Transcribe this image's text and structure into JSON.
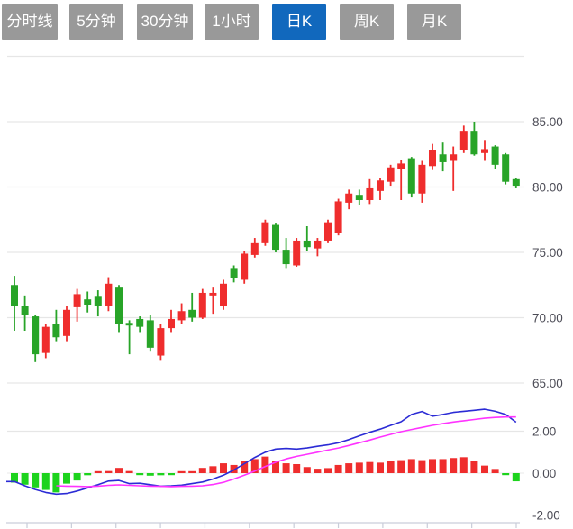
{
  "tabs": {
    "items": [
      {
        "label": "分时线",
        "active": false
      },
      {
        "label": "5分钟",
        "active": false
      },
      {
        "label": "30分钟",
        "active": false
      },
      {
        "label": "1小时",
        "active": false
      },
      {
        "label": "日K",
        "active": true
      },
      {
        "label": "周K",
        "active": false
      },
      {
        "label": "月K",
        "active": false
      }
    ]
  },
  "colors": {
    "tab_bg": "#999999",
    "tab_active_bg": "#1168bd",
    "tab_text": "#ffffff",
    "up": "#ef2d2d",
    "down": "#28a428",
    "macd_up": "#ef2d2d",
    "macd_down": "#1dd31d",
    "dif_line": "#2b2bd5",
    "dea_line": "#ff33ff",
    "grid": "#e6e6e6",
    "axis": "#c9cdd9",
    "label": "#4d4d57"
  },
  "chart_data": {
    "type": "candlestick",
    "title": "",
    "legend_position": "none",
    "grid": true,
    "price_axis": {
      "side": "right",
      "ticks": [
        "85.00",
        "80.00",
        "75.00",
        "70.00",
        "65.00"
      ],
      "tick_values": [
        85,
        80,
        75,
        70,
        65
      ],
      "unlabeled_top_grid_value": 90,
      "range": [
        63,
        90
      ]
    },
    "candles_ohlc": [
      [
        72.5,
        73.2,
        69.0,
        70.9
      ],
      [
        70.9,
        71.7,
        69.0,
        70.2
      ],
      [
        70.1,
        70.2,
        66.6,
        67.2
      ],
      [
        67.3,
        69.5,
        66.9,
        69.3
      ],
      [
        69.5,
        70.6,
        68.2,
        68.5
      ],
      [
        68.6,
        70.9,
        68.2,
        70.6
      ],
      [
        70.8,
        72.2,
        69.7,
        71.8
      ],
      [
        71.4,
        72.0,
        70.4,
        71.0
      ],
      [
        71.6,
        72.1,
        70.1,
        70.9
      ],
      [
        70.9,
        73.1,
        70.5,
        72.6
      ],
      [
        72.3,
        72.5,
        68.9,
        69.5
      ],
      [
        69.6,
        69.8,
        67.2,
        69.4
      ],
      [
        69.9,
        70.1,
        68.9,
        69.3
      ],
      [
        69.8,
        70.2,
        67.4,
        67.7
      ],
      [
        67.1,
        69.5,
        66.7,
        69.2
      ],
      [
        69.2,
        70.6,
        68.9,
        69.9
      ],
      [
        69.8,
        71.1,
        69.5,
        70.5
      ],
      [
        70.6,
        71.9,
        69.7,
        70.0
      ],
      [
        70.0,
        72.2,
        69.9,
        71.9
      ],
      [
        71.7,
        72.3,
        70.3,
        71.9
      ],
      [
        70.9,
        72.9,
        70.6,
        72.6
      ],
      [
        73.8,
        74.0,
        72.7,
        73.0
      ],
      [
        72.9,
        75.1,
        72.6,
        74.9
      ],
      [
        74.8,
        76.1,
        74.6,
        75.7
      ],
      [
        75.7,
        77.5,
        75.5,
        77.3
      ],
      [
        77.1,
        77.2,
        75.0,
        75.2
      ],
      [
        75.2,
        76.1,
        73.8,
        74.1
      ],
      [
        74.0,
        76.1,
        73.9,
        75.9
      ],
      [
        75.9,
        77.0,
        75.1,
        75.4
      ],
      [
        75.3,
        76.1,
        74.7,
        75.9
      ],
      [
        75.9,
        77.5,
        75.7,
        77.3
      ],
      [
        76.5,
        79.1,
        76.3,
        78.9
      ],
      [
        78.8,
        79.8,
        78.3,
        79.5
      ],
      [
        79.4,
        79.8,
        78.6,
        79.0
      ],
      [
        79.0,
        80.6,
        78.7,
        79.9
      ],
      [
        79.7,
        80.7,
        79.0,
        80.5
      ],
      [
        80.4,
        81.7,
        80.1,
        81.5
      ],
      [
        81.4,
        82.1,
        79.0,
        81.8
      ],
      [
        82.2,
        82.3,
        79.2,
        79.5
      ],
      [
        79.5,
        82.0,
        78.8,
        81.7
      ],
      [
        81.6,
        83.3,
        81.3,
        82.8
      ],
      [
        82.5,
        83.4,
        81.2,
        81.9
      ],
      [
        82.0,
        83.1,
        79.7,
        82.5
      ],
      [
        82.8,
        84.7,
        82.6,
        84.3
      ],
      [
        84.3,
        85.0,
        82.4,
        82.5
      ],
      [
        82.6,
        83.6,
        82.0,
        82.9
      ],
      [
        83.1,
        83.2,
        81.4,
        81.7
      ],
      [
        82.5,
        82.6,
        80.2,
        80.4
      ],
      [
        80.6,
        80.7,
        79.9,
        80.1
      ]
    ],
    "macd": {
      "axis_ticks": [
        "2.00",
        "0.00",
        "-2.00"
      ],
      "axis_tick_values": [
        2,
        0,
        -2
      ],
      "range": [
        -2.5,
        3.6
      ],
      "histogram": [
        -0.45,
        -0.55,
        -0.68,
        -0.8,
        -0.92,
        -0.5,
        -0.35,
        -0.1,
        0.06,
        0.1,
        0.25,
        0.1,
        -0.08,
        -0.12,
        -0.1,
        -0.06,
        0.05,
        0.08,
        0.25,
        0.33,
        0.47,
        0.39,
        0.57,
        0.67,
        0.79,
        0.57,
        0.47,
        0.43,
        0.29,
        0.21,
        0.24,
        0.39,
        0.47,
        0.5,
        0.53,
        0.5,
        0.57,
        0.62,
        0.67,
        0.62,
        0.67,
        0.67,
        0.72,
        0.76,
        0.57,
        0.36,
        0.2,
        -0.08,
        -0.39
      ],
      "dif": [
        -0.4,
        -0.6,
        -0.78,
        -0.92,
        -1.0,
        -0.97,
        -0.85,
        -0.7,
        -0.55,
        -0.38,
        -0.35,
        -0.5,
        -0.48,
        -0.55,
        -0.62,
        -0.6,
        -0.57,
        -0.5,
        -0.42,
        -0.28,
        -0.1,
        0.15,
        0.45,
        0.75,
        1.0,
        1.15,
        1.18,
        1.15,
        1.2,
        1.28,
        1.35,
        1.45,
        1.6,
        1.78,
        1.95,
        2.1,
        2.28,
        2.45,
        2.8,
        2.94,
        2.72,
        2.8,
        2.9,
        2.95,
        3.0,
        3.05,
        2.95,
        2.8,
        2.43
      ],
      "dea": [
        null,
        null,
        null,
        null,
        -0.6,
        -0.62,
        -0.63,
        -0.64,
        -0.62,
        -0.58,
        -0.56,
        -0.58,
        -0.6,
        -0.62,
        -0.63,
        -0.64,
        -0.63,
        -0.62,
        -0.6,
        -0.54,
        -0.44,
        -0.28,
        -0.1,
        0.1,
        0.32,
        0.52,
        0.68,
        0.8,
        0.9,
        1.0,
        1.1,
        1.2,
        1.32,
        1.45,
        1.58,
        1.72,
        1.85,
        1.98,
        2.08,
        2.18,
        2.28,
        2.36,
        2.44,
        2.5,
        2.56,
        2.62,
        2.66,
        2.68,
        2.68
      ]
    },
    "x_axis": {
      "tick_count": 12,
      "labels_visible": false
    }
  }
}
